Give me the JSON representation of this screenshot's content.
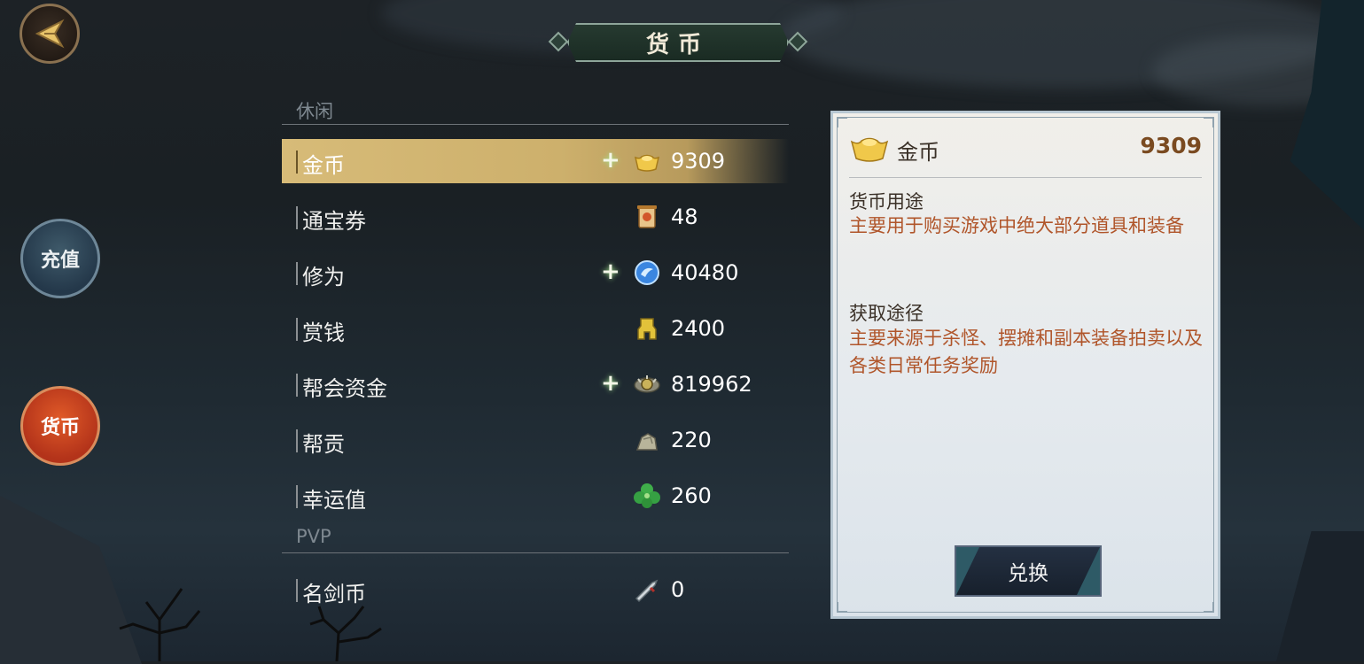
{
  "window": {
    "title": "货币"
  },
  "side_buttons": [
    {
      "label": "充值"
    },
    {
      "label": "货币"
    }
  ],
  "sections": [
    {
      "header": "休闲"
    },
    {
      "header": "PVP"
    }
  ],
  "currencies": [
    {
      "name": "金币",
      "amount": "9309",
      "icon": "gold-ingot-icon",
      "has_plus": true,
      "selected": true
    },
    {
      "name": "通宝券",
      "amount": "48",
      "icon": "ticket-scroll-icon",
      "has_plus": false
    },
    {
      "name": "修为",
      "amount": "40480",
      "icon": "spirit-orb-icon",
      "has_plus": true
    },
    {
      "name": "赏钱",
      "amount": "2400",
      "icon": "bounty-coin-icon",
      "has_plus": false
    },
    {
      "name": "帮会资金",
      "amount": "819962",
      "icon": "guild-funds-icon",
      "has_plus": true
    },
    {
      "name": "帮贡",
      "amount": "220",
      "icon": "guild-contribution-icon",
      "has_plus": false
    },
    {
      "name": "幸运值",
      "amount": "260",
      "icon": "clover-icon",
      "has_plus": false
    },
    {
      "name": "名剑币",
      "amount": "0",
      "icon": "sword-coin-icon",
      "has_plus": false
    }
  ],
  "detail": {
    "name": "金币",
    "amount": "9309",
    "usage_label": "货币用途",
    "usage_text": "主要用于购买游戏中绝大部分道具和装备",
    "source_label": "获取途径",
    "source_text": "主要来源于杀怪、摆摊和副本装备拍卖以及各类日常任务奖励",
    "exchange_label": "兑换"
  },
  "colors": {
    "accent_gold": "#d7bb78",
    "desc_orange": "#b0552a",
    "amount_brown": "#7a4a20"
  }
}
